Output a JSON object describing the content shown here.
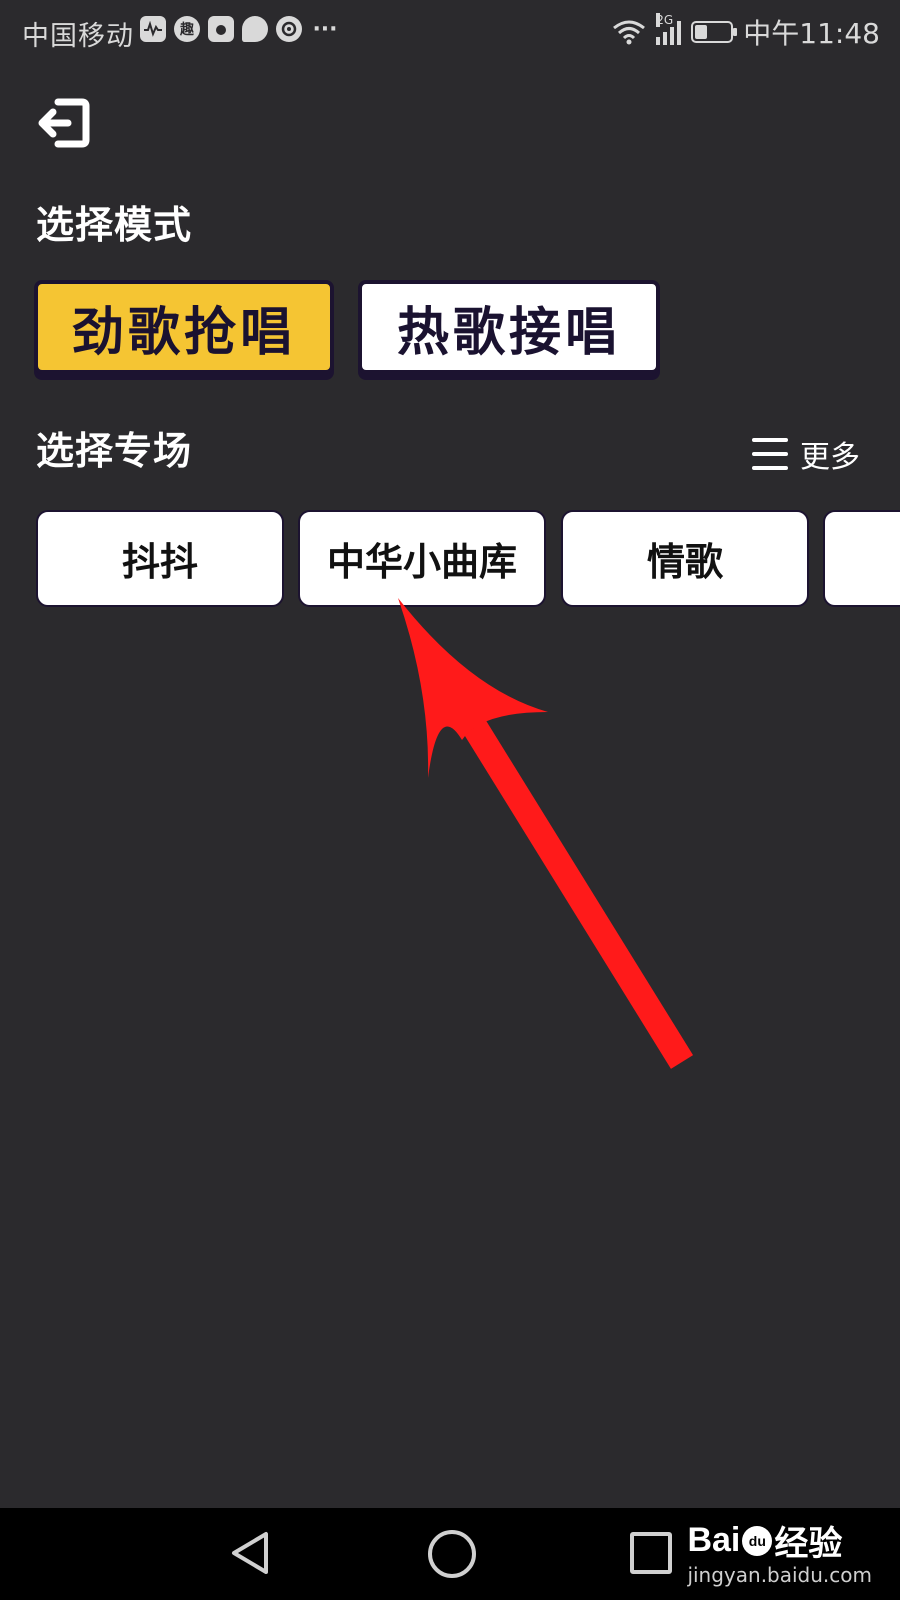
{
  "status_bar": {
    "carrier": "中国移动",
    "notification_icons": [
      "activity-icon",
      "qu-app-icon",
      "tomato-icon",
      "chat-icon",
      "camera-icon",
      "more-dots-icon"
    ],
    "qu_label": "趣",
    "more_dots": "···",
    "network": "2G",
    "battery_level": 0.35,
    "time": "中午11:48"
  },
  "header": {
    "exit_icon": "exit-icon"
  },
  "mode_section": {
    "title": "选择模式",
    "modes": [
      {
        "label": "劲歌抢唱",
        "selected": true
      },
      {
        "label": "热歌接唱",
        "selected": false
      }
    ]
  },
  "special_section": {
    "title": "选择专场",
    "more_label": "更多",
    "categories": [
      {
        "label": "抖抖"
      },
      {
        "label": "中华小曲库"
      },
      {
        "label": "情歌"
      },
      {
        "label": ""
      }
    ]
  },
  "annotation": {
    "arrow_color": "#ff1a1a"
  },
  "nav_bar": {
    "watermark_brand": "Bai",
    "watermark_brand_end": "经验",
    "watermark_paw": "du",
    "watermark_url": "jingyan.baidu.com"
  },
  "colors": {
    "background": "#2b2a2d",
    "accent_yellow": "#f5c533",
    "button_border": "#1c1330"
  }
}
